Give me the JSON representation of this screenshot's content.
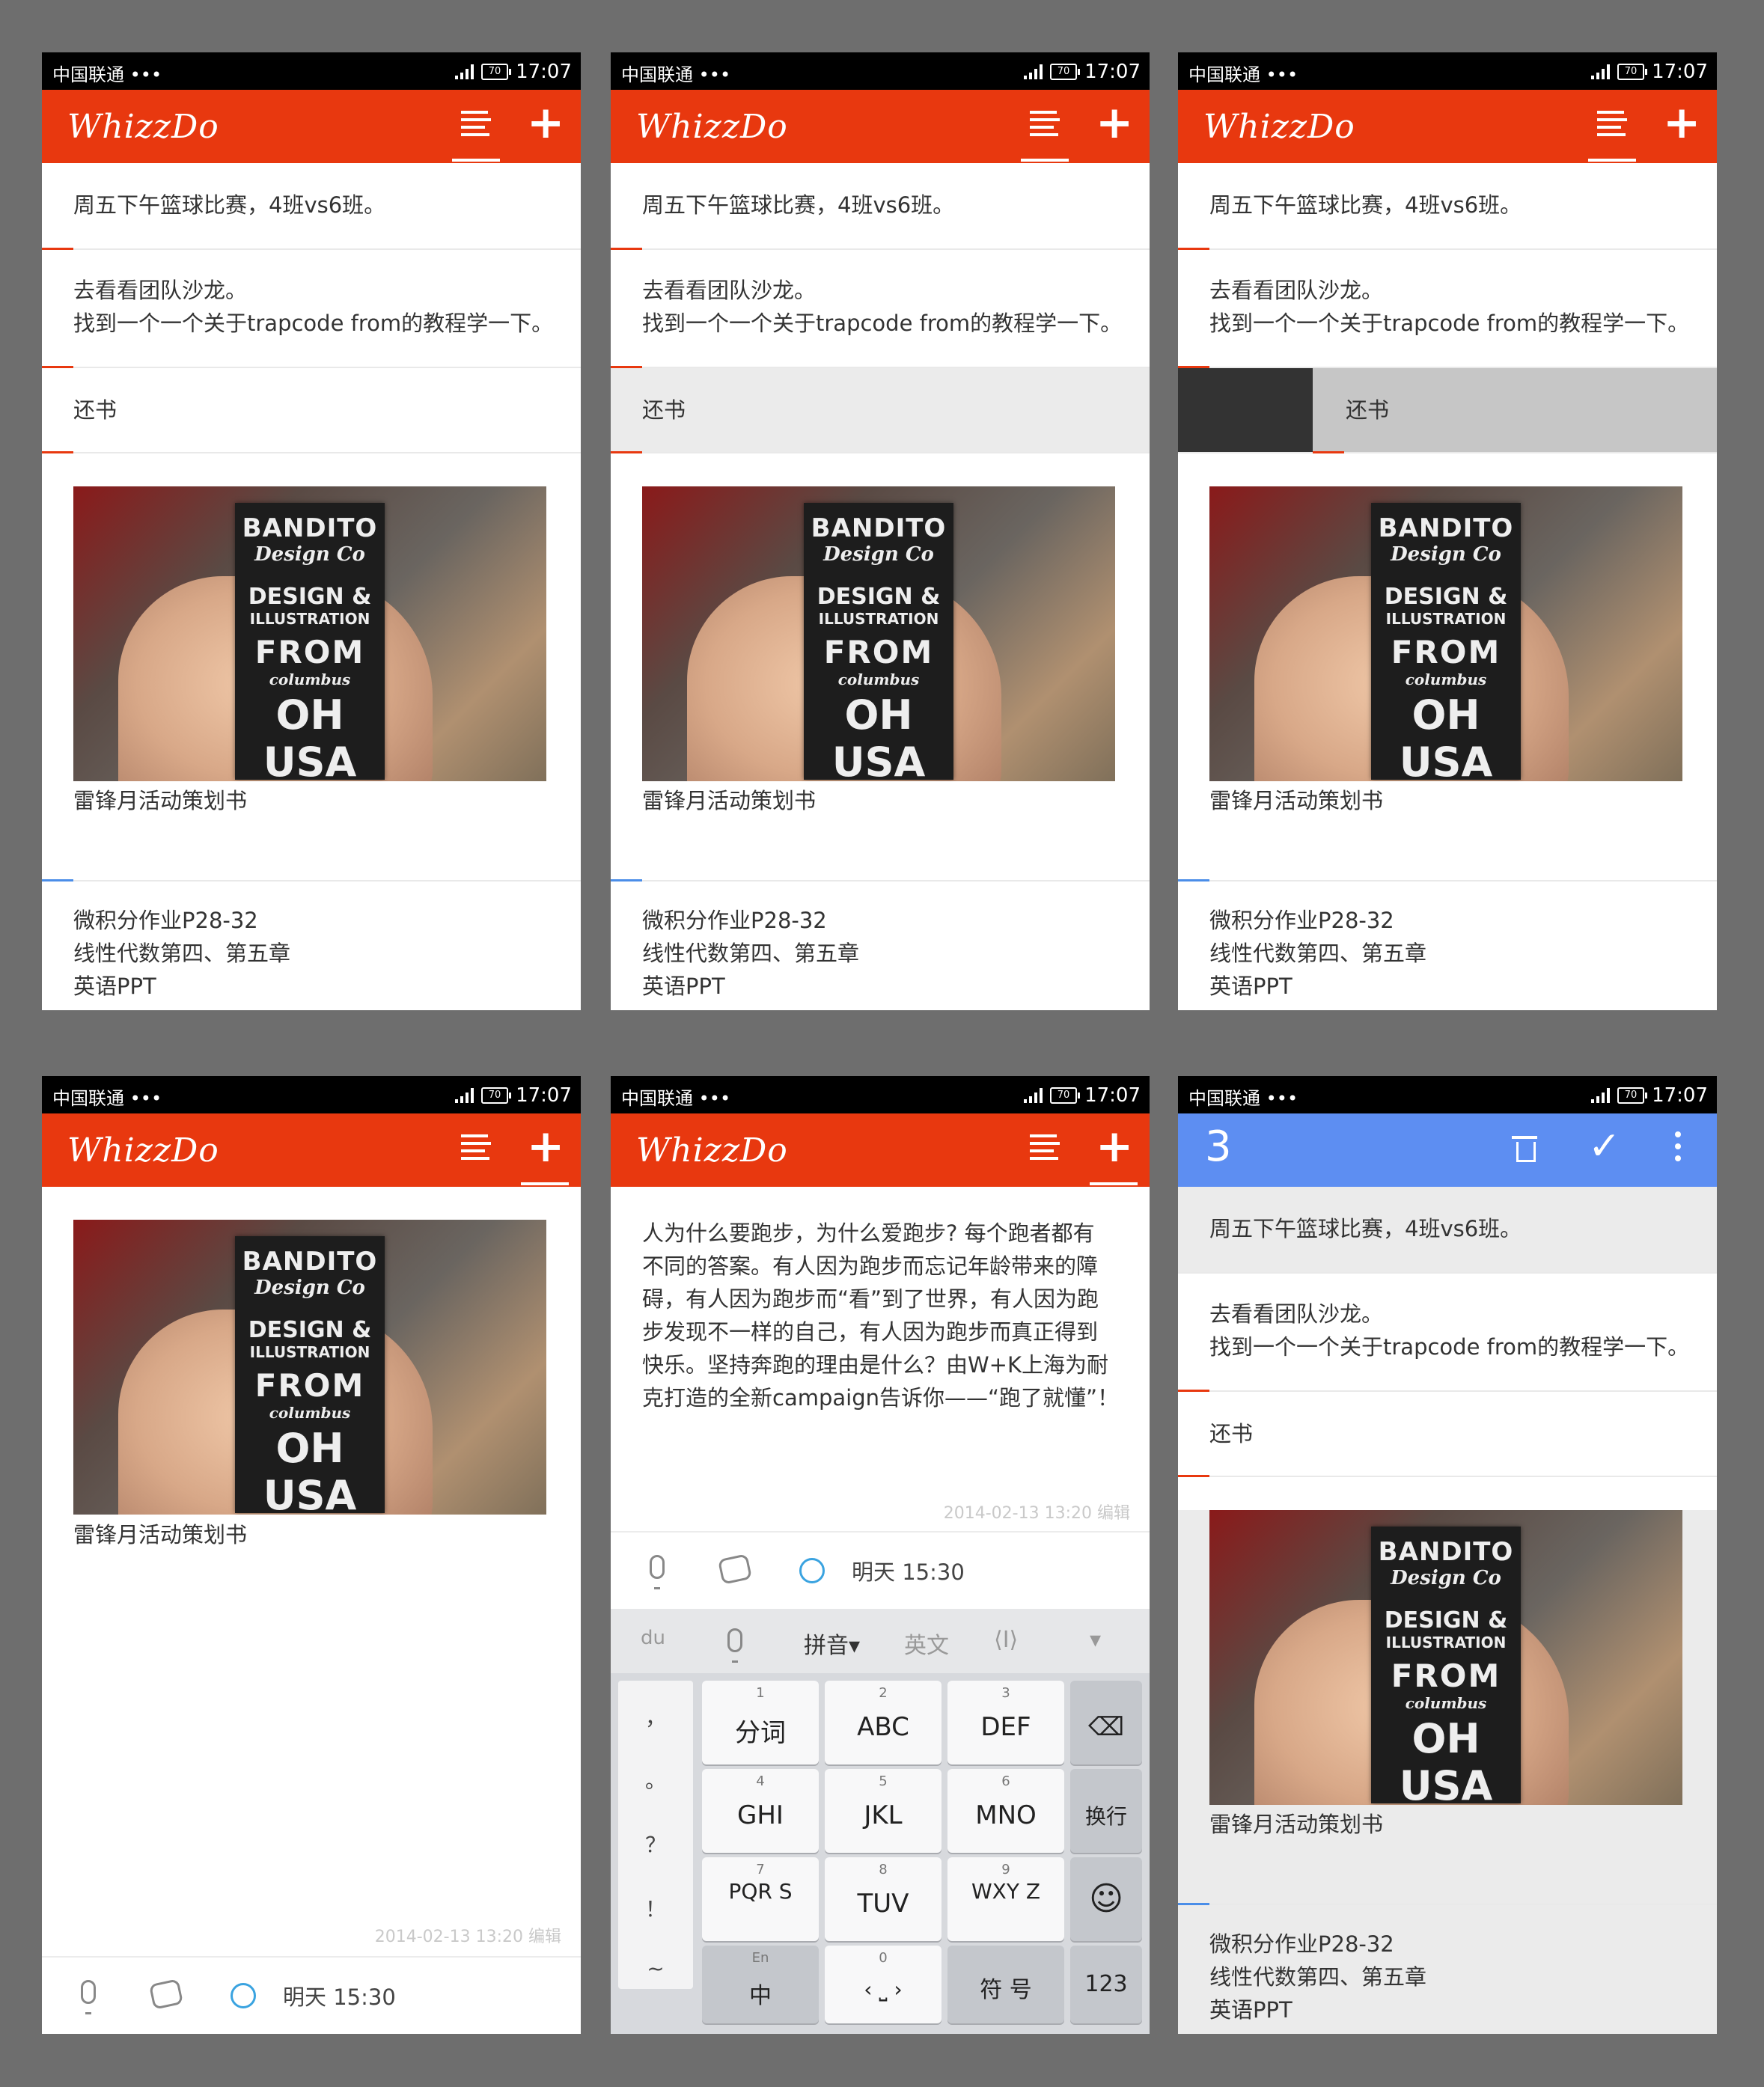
{
  "status": {
    "carrier": "中国联通 •••",
    "battery": "70",
    "time": "17:07"
  },
  "app": {
    "title": "WhizzDo"
  },
  "notes": {
    "n1": "周五下午篮球比赛，4班vs6班。",
    "n2_l1": "去看看团队沙龙。",
    "n2_l2": "找到一个一个关于trapcode from的教程学一下。",
    "n3": "还书",
    "n4": "雷锋月活动策划书",
    "n5_l1": "微积分作业P28-32",
    "n5_l2": "线性代数第四、第五章",
    "n5_l3": "英语PPT"
  },
  "card": {
    "l1": "BANDITO",
    "l2": "Design Co",
    "l3": "DESIGN &",
    "l4": "ILLUSTRATION",
    "l5": "FROM",
    "l6": "columbus",
    "l7": "OH USA"
  },
  "detail": {
    "timestamp": "2014-02-13 13:20 编辑",
    "reminder": "明天 15:30"
  },
  "editor": {
    "text_l1": "人为什么要跑步，为什么爱跑步? 每个跑者都有",
    "text_l2": "不同的答案。有人因为跑步而忘记年龄带来的障",
    "text_l3": "碍，有人因为跑步而“看”到了世界，有人因为跑",
    "text_l4": "步发现不一样的自己，有人因为跑步而真正得到",
    "text_l5": "快乐。坚持奔跑的理由是什么？由W+K上海为耐",
    "text_l6": "克打造的全新campaign告诉你——“跑了就懂”！"
  },
  "keyboard": {
    "top": {
      "logo": "du",
      "pinyin": "拼音▾",
      "english": "英文",
      "cursor": "⟨I⟩"
    },
    "symbols": [
      "，",
      "。",
      "？",
      "！",
      "~"
    ],
    "keys": [
      {
        "num": "1",
        "label": "分词"
      },
      {
        "num": "2",
        "label": "ABC"
      },
      {
        "num": "3",
        "label": "DEF"
      },
      {
        "num": "4",
        "label": "GHI"
      },
      {
        "num": "5",
        "label": "JKL"
      },
      {
        "num": "6",
        "label": "MNO"
      },
      {
        "num": "7",
        "label": "PQR S"
      },
      {
        "num": "8",
        "label": "TUV"
      },
      {
        "num": "9",
        "label": "WXY Z"
      },
      {
        "num": "En",
        "label": "中"
      },
      {
        "num": "0",
        "label": "‹ ⎵ ›"
      }
    ],
    "right": {
      "delete": "⌫",
      "enter": "换行",
      "emoji": "☺",
      "sym": "符 号",
      "num": "123"
    }
  },
  "selection": {
    "count": "3"
  },
  "colors": {
    "accent": "#e8380f",
    "selection_bar": "#5d8ef2",
    "background": "#6e6e6e"
  }
}
